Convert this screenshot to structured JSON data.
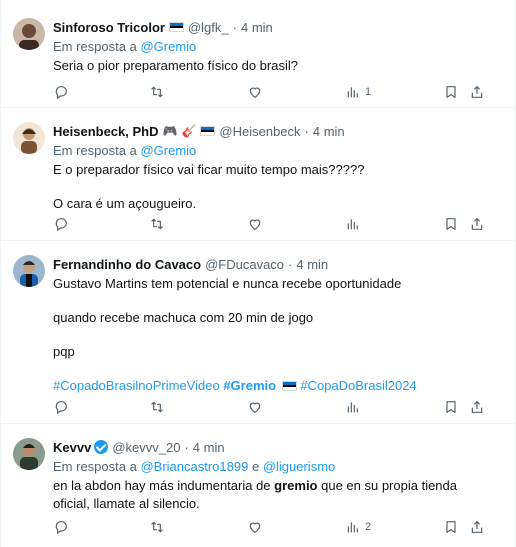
{
  "tweets": [
    {
      "name": "Sinforoso Tricolor",
      "handle": "@lgfk_",
      "time": "4 min",
      "reply_prefix": "Em resposta a",
      "reply_to": [
        "@Gremio"
      ],
      "lines": [
        "Seria o pior preparamento físico do brasil?"
      ],
      "views": "1",
      "avatar_color": "#6b4a3a"
    },
    {
      "name": "Heisenbeck, PhD",
      "handle": "@Heisenbeck",
      "time": "4 min",
      "reply_prefix": "Em resposta a",
      "reply_to": [
        "@Gremio"
      ],
      "lines": [
        "E o preparador físico vai ficar muito tempo mais?????",
        "O cara é um açougueiro."
      ],
      "views": "",
      "avatar_color": "#e8d8c8",
      "emojis": [
        "🎮",
        "🎸"
      ]
    },
    {
      "name": "Fernandinho do Cavaco",
      "handle": "@FDucavaco",
      "time": "4 min",
      "lines": [
        "Gustavo Martins tem potencial e nunca recebe oportunidade",
        "quando recebe machuca com 20 min de jogo",
        "pqp"
      ],
      "hashtags": [
        "#CopadoBrasilnoPrimeVideo",
        "#Gremio",
        "#CopaDoBrasil2024"
      ],
      "views": "",
      "avatar_color": "#5a7ea6"
    },
    {
      "name": "Kevvv",
      "handle": "@kevvv_20",
      "time": "4 min",
      "reply_prefix": "Em resposta a",
      "reply_to": [
        "@Briancastro1899",
        "@liguerismo"
      ],
      "reply_joiner": "e",
      "text_before_bold": "en la abdon hay más indumentaria de ",
      "bold_word": "gremio",
      "text_after_bold": " que en su propia tienda",
      "line2": "oficial, llamate al silencio.",
      "views": "2",
      "avatar_color": "#3d4a3f"
    }
  ],
  "colors": {
    "accent": "#1d9bf0",
    "secondary_text": "#536471",
    "primary_text": "#0f1419",
    "divider": "#eff3f4"
  },
  "icons": [
    "reply-icon",
    "retweet-icon",
    "like-icon",
    "views-icon",
    "bookmark-icon",
    "share-icon"
  ]
}
